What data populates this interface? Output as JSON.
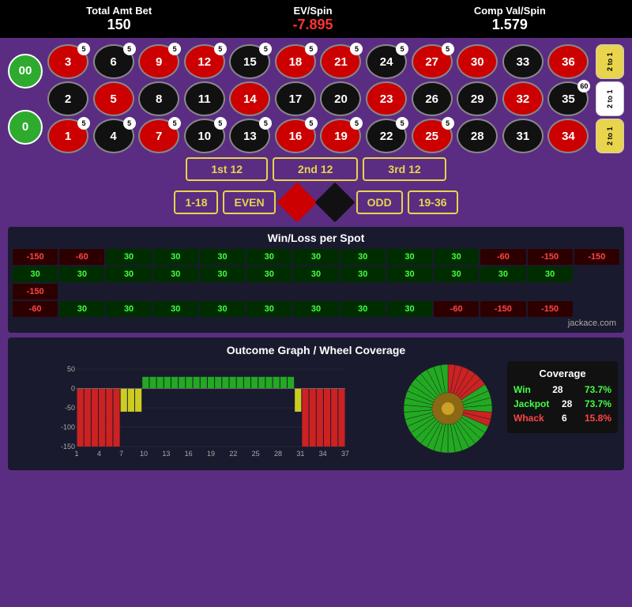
{
  "header": {
    "total_amt_bet_label": "Total Amt Bet",
    "total_amt_bet_value": "150",
    "ev_spin_label": "EV/Spin",
    "ev_spin_value": "-7.895",
    "comp_val_spin_label": "Comp Val/Spin",
    "comp_val_spin_value": "1.579"
  },
  "roulette": {
    "zeros": [
      "00",
      "0"
    ],
    "rows": [
      [
        {
          "num": "3",
          "color": "red",
          "bet": "5"
        },
        {
          "num": "6",
          "color": "black",
          "bet": "5"
        },
        {
          "num": "9",
          "color": "red",
          "bet": "5"
        },
        {
          "num": "12",
          "color": "red",
          "bet": "5"
        },
        {
          "num": "15",
          "color": "black",
          "bet": "5"
        },
        {
          "num": "18",
          "color": "red",
          "bet": "5"
        },
        {
          "num": "21",
          "color": "red",
          "bet": "5"
        },
        {
          "num": "24",
          "color": "black",
          "bet": "5"
        },
        {
          "num": "27",
          "color": "red",
          "bet": "5"
        },
        {
          "num": "30",
          "color": "red",
          "bet": ""
        },
        {
          "num": "33",
          "color": "black",
          "bet": ""
        },
        {
          "num": "36",
          "color": "red",
          "bet": ""
        }
      ],
      [
        {
          "num": "2",
          "color": "black",
          "bet": ""
        },
        {
          "num": "5",
          "color": "red",
          "bet": ""
        },
        {
          "num": "8",
          "color": "black",
          "bet": ""
        },
        {
          "num": "11",
          "color": "black",
          "bet": ""
        },
        {
          "num": "14",
          "color": "red",
          "bet": ""
        },
        {
          "num": "17",
          "color": "black",
          "bet": ""
        },
        {
          "num": "20",
          "color": "black",
          "bet": ""
        },
        {
          "num": "23",
          "color": "red",
          "bet": ""
        },
        {
          "num": "26",
          "color": "black",
          "bet": ""
        },
        {
          "num": "29",
          "color": "black",
          "bet": ""
        },
        {
          "num": "32",
          "color": "red",
          "bet": ""
        },
        {
          "num": "35",
          "color": "black",
          "bet": "60"
        }
      ],
      [
        {
          "num": "1",
          "color": "red",
          "bet": "5"
        },
        {
          "num": "4",
          "color": "black",
          "bet": "5"
        },
        {
          "num": "7",
          "color": "red",
          "bet": "5"
        },
        {
          "num": "10",
          "color": "black",
          "bet": "5"
        },
        {
          "num": "13",
          "color": "black",
          "bet": "5"
        },
        {
          "num": "16",
          "color": "red",
          "bet": "5"
        },
        {
          "num": "19",
          "color": "red",
          "bet": "5"
        },
        {
          "num": "22",
          "color": "black",
          "bet": "5"
        },
        {
          "num": "25",
          "color": "red",
          "bet": "5"
        },
        {
          "num": "28",
          "color": "black",
          "bet": ""
        },
        {
          "num": "31",
          "color": "black",
          "bet": ""
        },
        {
          "num": "34",
          "color": "red",
          "bet": ""
        }
      ]
    ],
    "side_bets": [
      "2 to 1",
      "2 to 1",
      "2 to 1"
    ],
    "dozens": [
      "1st 12",
      "2nd 12",
      "3rd 12"
    ],
    "outside": [
      "1-18",
      "EVEN",
      "ODD",
      "19-36"
    ]
  },
  "winloss": {
    "title": "Win/Loss per Spot",
    "rows": [
      [
        "-150",
        "-60",
        "30",
        "30",
        "30",
        "30",
        "30",
        "30",
        "30",
        "30",
        "-60",
        "-150",
        "-150"
      ],
      [
        "30",
        "30",
        "30",
        "30",
        "30",
        "30",
        "30",
        "30",
        "30",
        "30",
        "30",
        "30",
        ""
      ],
      [
        "-150",
        "",
        "",
        "",
        "",
        "",
        "",
        "",
        "",
        "",
        "",
        "",
        ""
      ],
      [
        "-60",
        "30",
        "30",
        "30",
        "30",
        "30",
        "30",
        "30",
        "30",
        "-60",
        "-150",
        "-150",
        ""
      ]
    ]
  },
  "outcome": {
    "title": "Outcome Graph / Wheel Coverage",
    "graph": {
      "x_labels": [
        "1",
        "4",
        "7",
        "10",
        "13",
        "16",
        "19",
        "22",
        "25",
        "28",
        "31",
        "34",
        "37"
      ],
      "y_labels": [
        "50",
        "0",
        "-50",
        "-100",
        "-150"
      ],
      "bars": [
        {
          "x": 1,
          "val": -150,
          "color": "red"
        },
        {
          "x": 2,
          "val": -150,
          "color": "red"
        },
        {
          "x": 3,
          "val": -150,
          "color": "red"
        },
        {
          "x": 4,
          "val": -150,
          "color": "red"
        },
        {
          "x": 5,
          "val": -150,
          "color": "red"
        },
        {
          "x": 6,
          "val": -150,
          "color": "red"
        },
        {
          "x": 7,
          "val": -60,
          "color": "yellow"
        },
        {
          "x": 8,
          "val": -60,
          "color": "yellow"
        },
        {
          "x": 9,
          "val": -60,
          "color": "yellow"
        },
        {
          "x": 10,
          "val": 30,
          "color": "green"
        },
        {
          "x": 11,
          "val": 30,
          "color": "green"
        },
        {
          "x": 12,
          "val": 30,
          "color": "green"
        },
        {
          "x": 13,
          "val": 30,
          "color": "green"
        },
        {
          "x": 14,
          "val": 30,
          "color": "green"
        },
        {
          "x": 15,
          "val": 30,
          "color": "green"
        },
        {
          "x": 16,
          "val": 30,
          "color": "green"
        },
        {
          "x": 17,
          "val": 30,
          "color": "green"
        },
        {
          "x": 18,
          "val": 30,
          "color": "green"
        },
        {
          "x": 19,
          "val": 30,
          "color": "green"
        },
        {
          "x": 20,
          "val": 30,
          "color": "green"
        },
        {
          "x": 21,
          "val": 30,
          "color": "green"
        },
        {
          "x": 22,
          "val": 30,
          "color": "green"
        },
        {
          "x": 23,
          "val": 30,
          "color": "green"
        },
        {
          "x": 24,
          "val": 30,
          "color": "green"
        },
        {
          "x": 25,
          "val": 30,
          "color": "green"
        },
        {
          "x": 26,
          "val": 30,
          "color": "green"
        },
        {
          "x": 27,
          "val": 30,
          "color": "green"
        },
        {
          "x": 28,
          "val": 30,
          "color": "green"
        },
        {
          "x": 29,
          "val": 30,
          "color": "green"
        },
        {
          "x": 30,
          "val": 30,
          "color": "green"
        },
        {
          "x": 31,
          "val": -60,
          "color": "yellow"
        },
        {
          "x": 32,
          "val": -150,
          "color": "red"
        },
        {
          "x": 33,
          "val": -150,
          "color": "red"
        },
        {
          "x": 34,
          "val": -150,
          "color": "red"
        },
        {
          "x": 35,
          "val": -150,
          "color": "red"
        },
        {
          "x": 36,
          "val": -150,
          "color": "red"
        },
        {
          "x": 37,
          "val": -150,
          "color": "red"
        }
      ]
    },
    "coverage": {
      "title": "Coverage",
      "win_label": "Win",
      "win_count": "28",
      "win_pct": "73.7%",
      "jackpot_label": "Jackpot",
      "jackpot_count": "28",
      "jackpot_pct": "73.7%",
      "whack_label": "Whack",
      "whack_count": "6",
      "whack_pct": "15.8%"
    }
  },
  "footer": "jackace.com"
}
